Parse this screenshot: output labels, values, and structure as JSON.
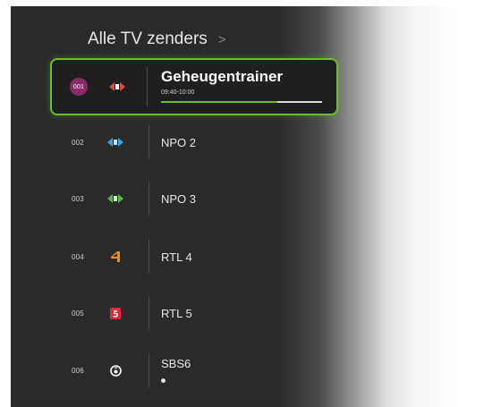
{
  "header": {
    "title": "Alle TV zenders",
    "chevron": ">"
  },
  "channels": [
    {
      "number": "001",
      "name": "Geheugentrainer",
      "time": "09:40-10:00",
      "logo": "npo1-logo-icon",
      "progress": 0.72,
      "selected": true
    },
    {
      "number": "002",
      "name": "NPO 2",
      "logo": "npo2-logo-icon"
    },
    {
      "number": "003",
      "name": "NPO 3",
      "logo": "npo3-logo-icon"
    },
    {
      "number": "004",
      "name": "RTL 4",
      "logo": "rtl4-logo-icon"
    },
    {
      "number": "005",
      "name": "RTL 5",
      "logo": "rtl5-logo-icon"
    },
    {
      "number": "006",
      "name": "SBS6",
      "logo": "sbs6-logo-icon"
    }
  ],
  "colors": {
    "accent": "#6bbf2a",
    "badge": "#8a2a6a",
    "npo1": "#e8473c",
    "npo2": "#3aa0e0",
    "npo3": "#52b84a",
    "rtl4": "#f08a1e",
    "rtl5": "#e0283c",
    "sbs6": "#ffffff"
  }
}
